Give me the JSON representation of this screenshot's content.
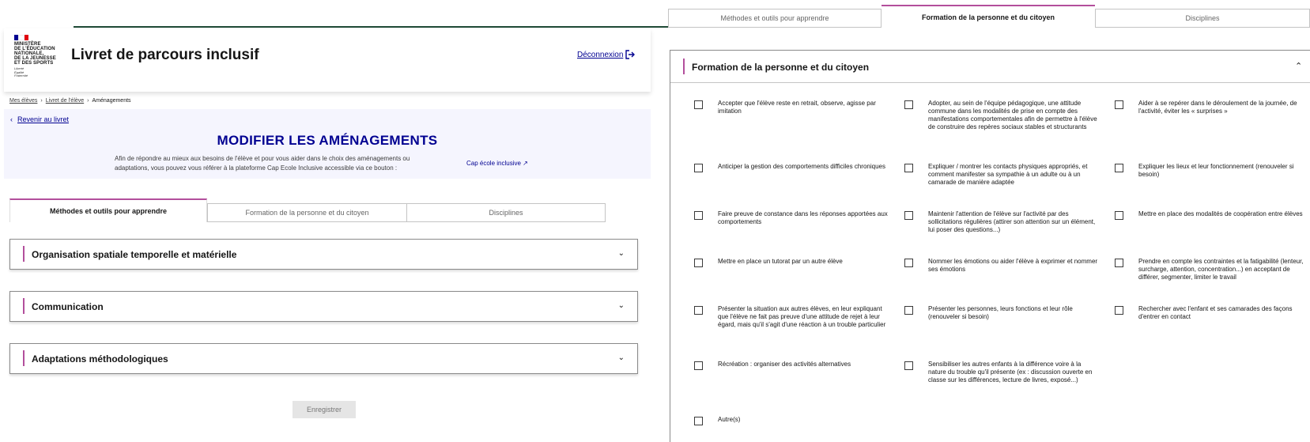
{
  "header": {
    "logo_lines": [
      "Ministère",
      "de l'Éducation",
      "nationale,",
      "de la Jeunesse",
      "et des Sports"
    ],
    "logo_motto": [
      "Liberté",
      "Égalité",
      "Fraternité"
    ],
    "app_title": "Livret de parcours inclusif",
    "logout_label": "Déconnexion"
  },
  "breadcrumb": {
    "items": [
      "Mes élèves",
      "Livret de l'élève"
    ],
    "current": "Aménagements"
  },
  "banner": {
    "back_label": "Revenir au livret",
    "title": "MODIFIER LES AMÉNAGEMENTS",
    "intro": "Afin de répondre au mieux aux besoins de l'élève et pour vous aider dans le choix des aménagements ou adaptations, vous pouvez vous référer à la plateforme Cap Ecole Inclusive accessible via ce bouton :",
    "cap_link_label": "Cap école inclusive"
  },
  "tabs": [
    "Méthodes et outils pour apprendre",
    "Formation de la personne et du citoyen",
    "Disciplines"
  ],
  "accordions": [
    "Organisation spatiale temporelle et matérielle",
    "Communication",
    "Adaptations méthodologiques"
  ],
  "save_label": "Enregistrer",
  "right_panel": {
    "title": "Formation de la personne et du citoyen",
    "options": [
      "Accepter que l'élève reste en retrait, observe, agisse par imitation",
      "Adopter, au sein de l'équipe pédagogique, une attitude commune dans les modalités de prise en compte des manifestations comportementales afin de permettre à l'élève de construire des repères sociaux stables et structurants",
      "Aider à se repérer dans le déroulement de la journée, de l'activité, éviter les « surprises »",
      "Anticiper la gestion des comportements difficiles chroniques",
      "Expliquer / montrer les contacts physiques appropriés, et comment manifester sa sympathie à un adulte ou à un camarade de manière adaptée",
      "Expliquer les lieux et leur fonctionnement (renouveler si besoin)",
      "Faire preuve de constance dans les réponses apportées aux comportements",
      "Maintenir l'attention de l'élève sur l'activité par des sollicitations régulières (attirer son attention sur un élément, lui poser des questions...)",
      "Mettre en place des modalités de coopération entre élèves",
      "Mettre en place un tutorat par un autre élève",
      "Nommer les émotions ou aider l'élève à exprimer et nommer ses émotions",
      "Prendre en compte les contraintes et la fatigabilité (lenteur, surcharge, attention, concentration...) en acceptant de différer, segmenter, limiter le travail",
      "Présenter la situation aux autres élèves, en leur expliquant que l'élève ne fait pas preuve d'une attitude de rejet à leur égard, mais qu'il s'agit d'une réaction à un trouble particulier",
      "Présenter les personnes, leurs fonctions et leur rôle (renouveler si besoin)",
      "Rechercher avec l'enfant et ses camarades des façons d'entrer en contact",
      "Récréation : organiser des activités alternatives",
      "Sensibiliser les autres enfants à la différence voire à la nature du trouble qu'il présente (ex : discussion ouverte en classe sur les différences, lecture de livres, exposé...)",
      "Autre(s)"
    ]
  },
  "colors": {
    "accent": "#000091",
    "tab_accent": "#b34f9c",
    "flag_blue": "#000091",
    "flag_red": "#e1000f"
  }
}
